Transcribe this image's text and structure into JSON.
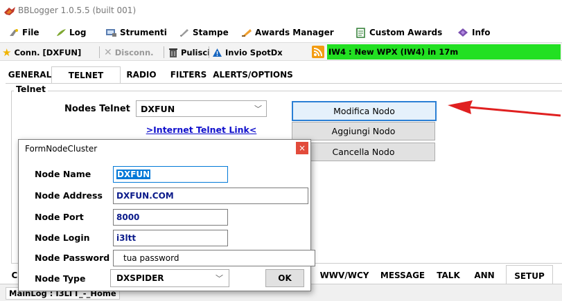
{
  "window": {
    "title": "BBLogger 1.0.5.5 (built 001)"
  },
  "menu": [
    {
      "label": "File",
      "icon": "file-icon"
    },
    {
      "label": "Log",
      "icon": "log-icon"
    },
    {
      "label": "Strumenti",
      "icon": "tools-icon"
    },
    {
      "label": "Stampe",
      "icon": "print-icon"
    },
    {
      "label": "Awards Manager",
      "icon": "awards-icon"
    },
    {
      "label": "Custom Awards",
      "icon": "custom-awards-icon"
    },
    {
      "label": "Info",
      "icon": "info-icon"
    }
  ],
  "toolbar": {
    "connect_label": "Conn. [DXFUN]",
    "disconnect_label": "Disconn.",
    "clear_label": "Pulisci",
    "spot_label": "Invio SpotDx",
    "alert_text": "IW4 : New WPX (IW4) in 17m",
    "alert_color": "#22e022"
  },
  "tabs": [
    {
      "label": "GENERAL",
      "active": false
    },
    {
      "label": "TELNET",
      "active": true
    },
    {
      "label": "RADIO",
      "active": false
    },
    {
      "label": "FILTERS",
      "active": false
    },
    {
      "label": "ALERTS/OPTIONS",
      "active": false
    }
  ],
  "telnet": {
    "group_label": "Telnet",
    "nodes_label": "Nodes Telnet",
    "nodes_value": "DXFUN",
    "link_text": ">Internet Telnet Link<",
    "edit_button": "Modifica Nodo",
    "add_button": "Aggiungi Nodo",
    "delete_button": "Cancella Nodo"
  },
  "dialog": {
    "title": "FormNodeCluster",
    "close_glyph": "×",
    "fields": {
      "node_name_label": "Node Name",
      "node_name_value": "DXFUN",
      "node_address_label": "Node Address",
      "node_address_value": "DXFUN.COM",
      "node_port_label": "Node Port",
      "node_port_value": "8000",
      "node_login_label": "Node Login",
      "node_login_value": "i3ltt",
      "node_password_label": "Node Password",
      "node_password_value": "tua password",
      "node_type_label": "Node Type",
      "node_type_value": "DXSPIDER"
    },
    "ok_label": "OK"
  },
  "bottom_tabs": [
    {
      "label": "Cl",
      "active": false
    },
    {
      "label": "WWV/WCY",
      "active": false
    },
    {
      "label": "MESSAGE",
      "active": false
    },
    {
      "label": "TALK",
      "active": false
    },
    {
      "label": "ANN",
      "active": false
    },
    {
      "label": "SETUP",
      "active": true
    }
  ],
  "status": {
    "text": "MainLog : I3LTT_-_Home"
  },
  "colors": {
    "accent": "#2a7fd4",
    "arrow": "#e02020",
    "link": "#1010cc"
  }
}
